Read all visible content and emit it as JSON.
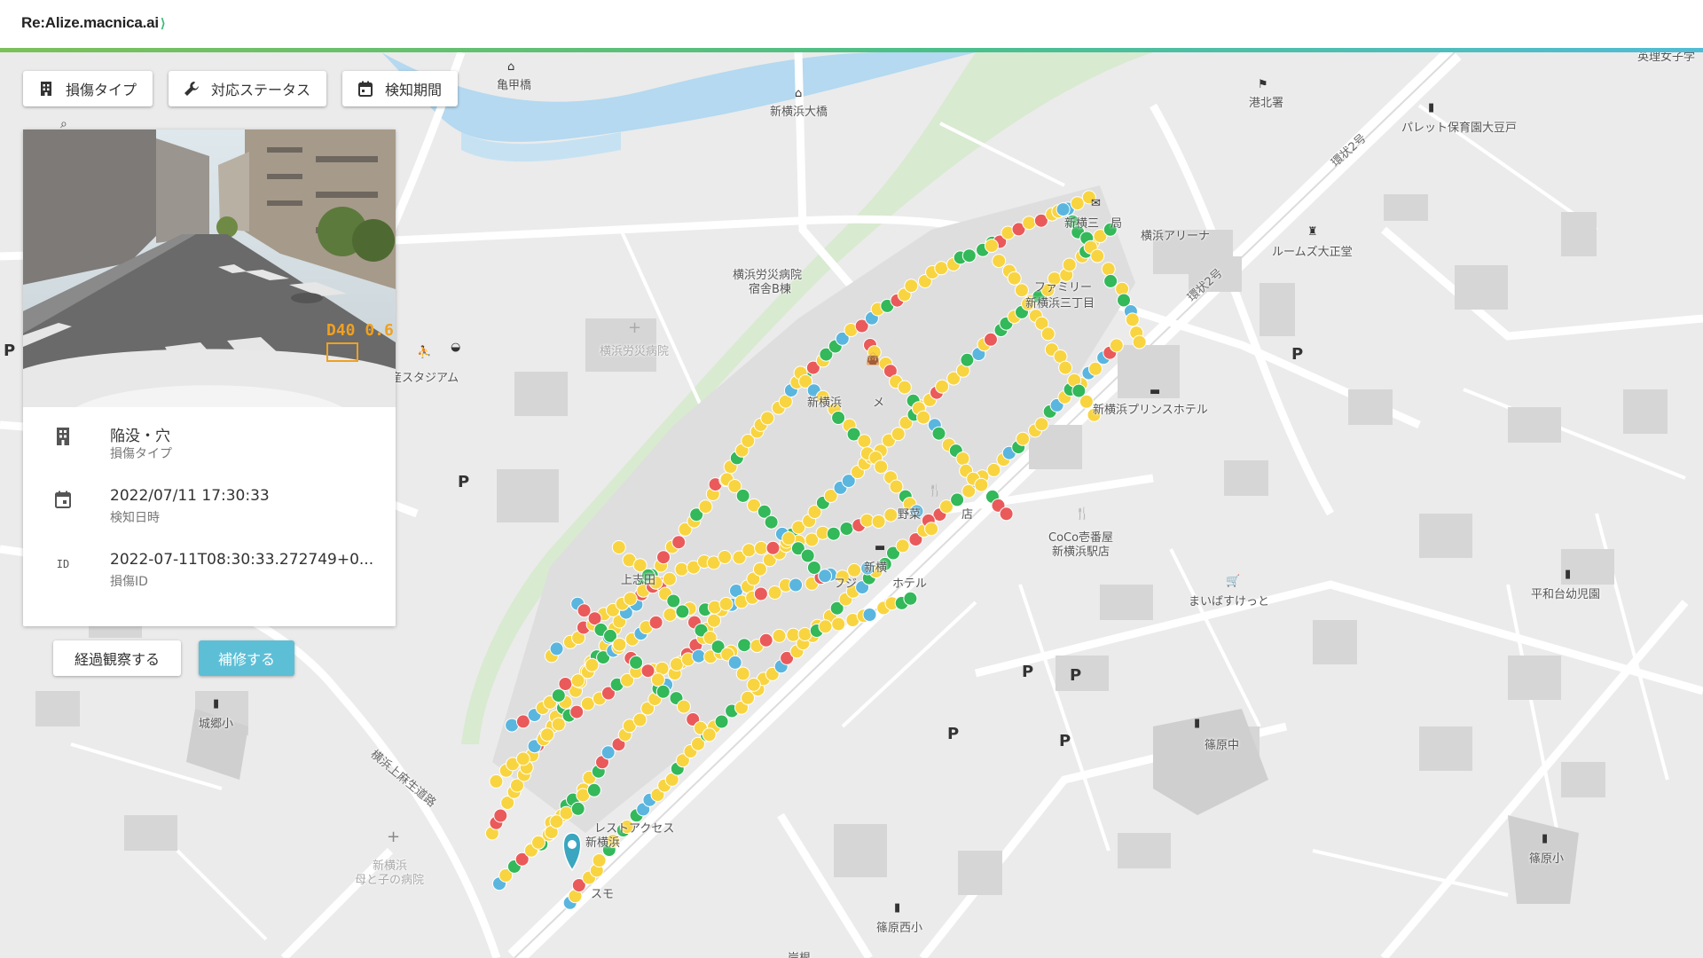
{
  "header": {
    "logo_text": "Re:Alize.macnica.ai",
    "accent_colors": [
      "#7cc05a",
      "#4bbf8a",
      "#52bcd6"
    ]
  },
  "filters": [
    {
      "label": "損傷タイプ",
      "icon": "building-icon"
    },
    {
      "label": "対応ステータス",
      "icon": "wrench-icon"
    },
    {
      "label": "検知期間",
      "icon": "calendar-icon"
    }
  ],
  "detail": {
    "photo_overlay_text": "D40 0.6",
    "rows": [
      {
        "icon": "building-icon",
        "value": "陥没・穴",
        "label": "損傷タイプ"
      },
      {
        "icon": "calendar-icon",
        "value": "2022/07/11 17:30:33",
        "label": "検知日時"
      },
      {
        "icon": "id-icon",
        "icon_text": "ID",
        "value": "2022-07-11T08:30:33.272749+0...",
        "label": "損傷ID"
      }
    ]
  },
  "actions": {
    "observe_label": "経過観察する",
    "repair_label": "補修する"
  },
  "map": {
    "labels": [
      {
        "text": "亀甲橋",
        "cls": ""
      },
      {
        "text": "新横浜大橋",
        "cls": ""
      },
      {
        "text": "横浜労災病院",
        "cls": ""
      },
      {
        "text": "宿舎B棟",
        "cls": ""
      },
      {
        "text": "横浜労災病院",
        "cls": ""
      },
      {
        "text": "産スタジアム",
        "cls": ""
      },
      {
        "text": "新横浜",
        "cls": ""
      },
      {
        "text": "メ",
        "cls": ""
      },
      {
        "text": "野菜",
        "cls": ""
      },
      {
        "text": "店",
        "cls": ""
      },
      {
        "text": "新横",
        "cls": ""
      },
      {
        "text": "フジ",
        "cls": ""
      },
      {
        "text": "ホテル",
        "cls": ""
      },
      {
        "text": "上志田",
        "cls": ""
      },
      {
        "text": "新横三",
        "cls": ""
      },
      {
        "text": "局",
        "cls": ""
      },
      {
        "text": "横浜アリーナ",
        "cls": ""
      },
      {
        "text": "ファミリー",
        "cls": ""
      },
      {
        "text": "新横浜三丁目",
        "cls": ""
      },
      {
        "text": "新横浜プリンスホテル",
        "cls": ""
      },
      {
        "text": "CoCo壱番屋",
        "cls": ""
      },
      {
        "text": "新横浜駅店",
        "cls": ""
      },
      {
        "text": "まいばすけっと",
        "cls": ""
      },
      {
        "text": "平和台幼児園",
        "cls": ""
      },
      {
        "text": "篠原中",
        "cls": ""
      },
      {
        "text": "篠原小",
        "cls": ""
      },
      {
        "text": "篠原西小",
        "cls": ""
      },
      {
        "text": "城郷小",
        "cls": ""
      },
      {
        "text": "新横浜",
        "cls": ""
      },
      {
        "text": "母と子の病院",
        "cls": ""
      },
      {
        "text": "レストアクセス",
        "cls": ""
      },
      {
        "text": "新横浜",
        "cls": ""
      },
      {
        "text": "スモ",
        "cls": ""
      },
      {
        "text": "岸根",
        "cls": ""
      },
      {
        "text": "ルームズ大正堂",
        "cls": ""
      },
      {
        "text": "パレット保育園大豆戸",
        "cls": ""
      },
      {
        "text": "港北署",
        "cls": ""
      },
      {
        "text": "英理女子学",
        "cls": ""
      },
      {
        "text": "環状2号",
        "cls": "road"
      },
      {
        "text": "環状2号",
        "cls": "road"
      },
      {
        "text": "横浜上麻生道路",
        "cls": "road"
      }
    ],
    "parking_symbol": "P",
    "damage_status_colors": {
      "repair_needed": "#ea5a5a",
      "observe": "#f8d440",
      "repaired": "#33b85a",
      "reported": "#5ab6de"
    },
    "selected_marker_color": "#3aa6c0"
  }
}
